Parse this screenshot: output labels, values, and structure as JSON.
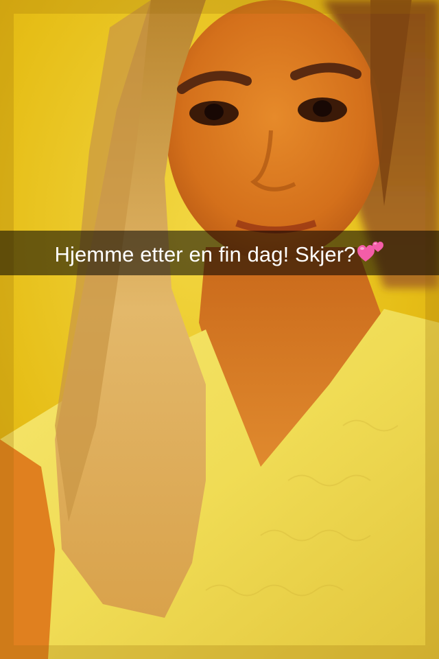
{
  "snap": {
    "caption": "Hjemme etter en fin dag! Skjer?",
    "caption_emoji": "two-hearts-icon"
  },
  "colors": {
    "background_wall": "#E8C21C",
    "caption_bar": "rgba(0,0,0,0.55)",
    "caption_text": "#FFFFFF",
    "heart": "#F45DA8"
  }
}
